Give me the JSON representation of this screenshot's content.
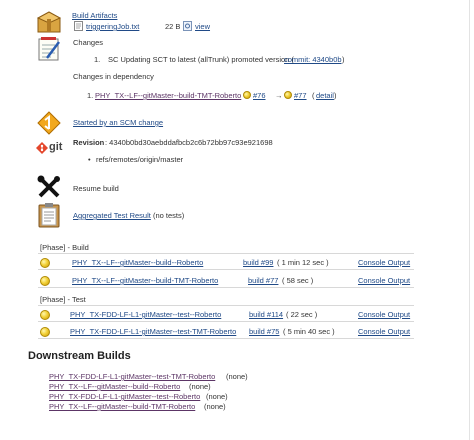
{
  "artifacts": {
    "title": "Build Artifacts",
    "file_name": "triggeringJob.txt",
    "file_size": "22 B",
    "view_label": "view"
  },
  "changes": {
    "title": "Changes",
    "item_number": "1.",
    "item_text": "SC Updating SCT to latest (allTrunk) promoted version (",
    "commit_link": "commit: 4340b0b",
    "item_close": ")",
    "dependency_title": "Changes in dependency",
    "dep_number": "1.",
    "dep_link": "PHY_TX--LF--gitMaster--build-TMT-Roberto",
    "dep_from": "#76",
    "dep_arrow": "→",
    "dep_to": "#77",
    "dep_detail": "detail",
    "dep_paren_open": "(",
    "dep_paren_close": ")"
  },
  "scm": {
    "started_by": "Started by an SCM change"
  },
  "git": {
    "logo_text": "git",
    "revision_label": "Revision",
    "revision_value": ": 4340b0bd30aebddafbcb2c6b72bb97c93e921698",
    "refs": "refs/remotes/origin/master"
  },
  "resume": {
    "label": "Resume build"
  },
  "tests": {
    "link": "Aggregated Test Result",
    "note": "(no tests)"
  },
  "phases": [
    {
      "title": "[Phase] - Build",
      "rows": [
        {
          "job": "PHY_TX--LF--gitMaster--build--Roberto",
          "build": "build #99",
          "duration": "( 1 min 12 sec )",
          "console": "Console Output"
        },
        {
          "job": "PHY_TX--LF--gitMaster--build-TMT-Roberto",
          "build": "build #77",
          "duration": "( 58 sec )",
          "console": "Console Output"
        }
      ]
    },
    {
      "title": "[Phase] - Test",
      "rows": [
        {
          "job": "PHY_TX-FDD-LF-L1-gitMaster--test--Roberto",
          "build": "build #114",
          "duration": "( 22 sec )",
          "console": "Console Output"
        },
        {
          "job": "PHY_TX-FDD-LF-L1-gitMaster--test-TMT-Roberto",
          "build": "build #75",
          "duration": "( 5 min 40 sec )",
          "console": "Console Output"
        }
      ]
    }
  ],
  "downstream": {
    "title": "Downstream Builds",
    "items": [
      {
        "job": "PHY_TX-FDD-LF-L1-gitMaster--test-TMT-Roberto",
        "status": "(none)"
      },
      {
        "job": "PHY_TX--LF--gitMaster--build--Roberto",
        "status": "(none)"
      },
      {
        "job": "PHY_TX-FDD-LF-L1-gitMaster--test--Roberto",
        "status": "(none)"
      },
      {
        "job": "PHY_TX--LF--gitMaster--build-TMT-Roberto",
        "status": "(none)"
      }
    ]
  }
}
